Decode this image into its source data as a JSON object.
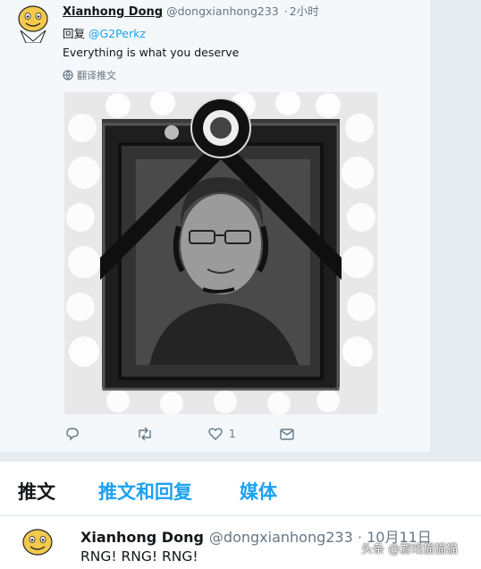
{
  "tweet": {
    "author_name": "Xianhong Dong",
    "author_handle": "@dongxianhong233",
    "separator": "·",
    "time": "2小时",
    "reply_prefix": "回复",
    "reply_mention": "@G2Perkz",
    "text": "Everything is what you deserve",
    "translate_label": "翻译推文",
    "avatar_icon": "cartoon-face-avatar",
    "image_icon": "memorial-portrait-image",
    "actions": {
      "reply_icon": "reply-icon",
      "retweet_icon": "retweet-icon",
      "like_icon": "like-heart-icon",
      "like_count": "1",
      "message_icon": "direct-message-icon"
    }
  },
  "tabs": [
    {
      "label": "推文",
      "active": true
    },
    {
      "label": "推文和回复",
      "active": false
    },
    {
      "label": "媒体",
      "active": false
    }
  ],
  "second_tweet": {
    "author_name": "Xianhong Dong",
    "author_handle": "@dongxianhong233",
    "separator": "·",
    "date": "10月11日",
    "text": "RNG! RNG! RNG!"
  },
  "watermark": "头条 @游戏猫猫猫",
  "colors": {
    "accent": "#1da1f2",
    "text": "#14171a",
    "muted": "#657786"
  }
}
